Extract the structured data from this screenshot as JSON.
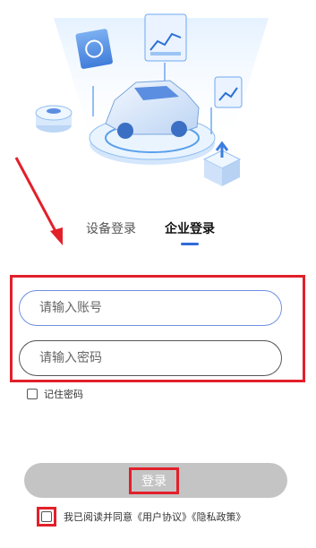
{
  "tabs": {
    "device_label": "设备登录",
    "enterprise_label": "企业登录"
  },
  "form": {
    "account_placeholder": "请输入账号",
    "password_placeholder": "请输入密码",
    "remember_label": "记住密码"
  },
  "login": {
    "button_label": "登录"
  },
  "agreement": {
    "prefix": "我已阅读并同意",
    "user_agreement": "《用户协议》",
    "privacy_policy": "《隐私政策》"
  },
  "colors": {
    "accent": "#2f6bd8",
    "annotation_red": "#e2202a",
    "button_disabled": "#c4c4c4"
  }
}
